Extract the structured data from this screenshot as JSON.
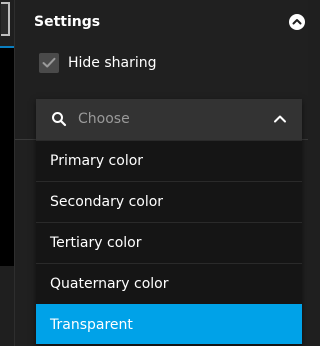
{
  "settings": {
    "title": "Settings",
    "hide_sharing": {
      "label": "Hide sharing",
      "checked": true
    }
  },
  "dropdown": {
    "placeholder": "Choose",
    "expanded": true,
    "options": [
      {
        "label": "Primary color",
        "selected": false
      },
      {
        "label": "Secondary color",
        "selected": false
      },
      {
        "label": "Tertiary color",
        "selected": false
      },
      {
        "label": "Quaternary color",
        "selected": false
      },
      {
        "label": "Transparent",
        "selected": true
      }
    ]
  },
  "icons": {
    "collapse": "chevron-up-circle-icon",
    "checkbox": "checkmark-icon",
    "search": "search-icon",
    "toggle": "chevron-up-icon"
  },
  "colors": {
    "panel_background": "#202020",
    "selected_option": "#00a2e8",
    "text": "#ffffff",
    "placeholder": "#9a9a9a",
    "accent": "#0a7ec0"
  }
}
